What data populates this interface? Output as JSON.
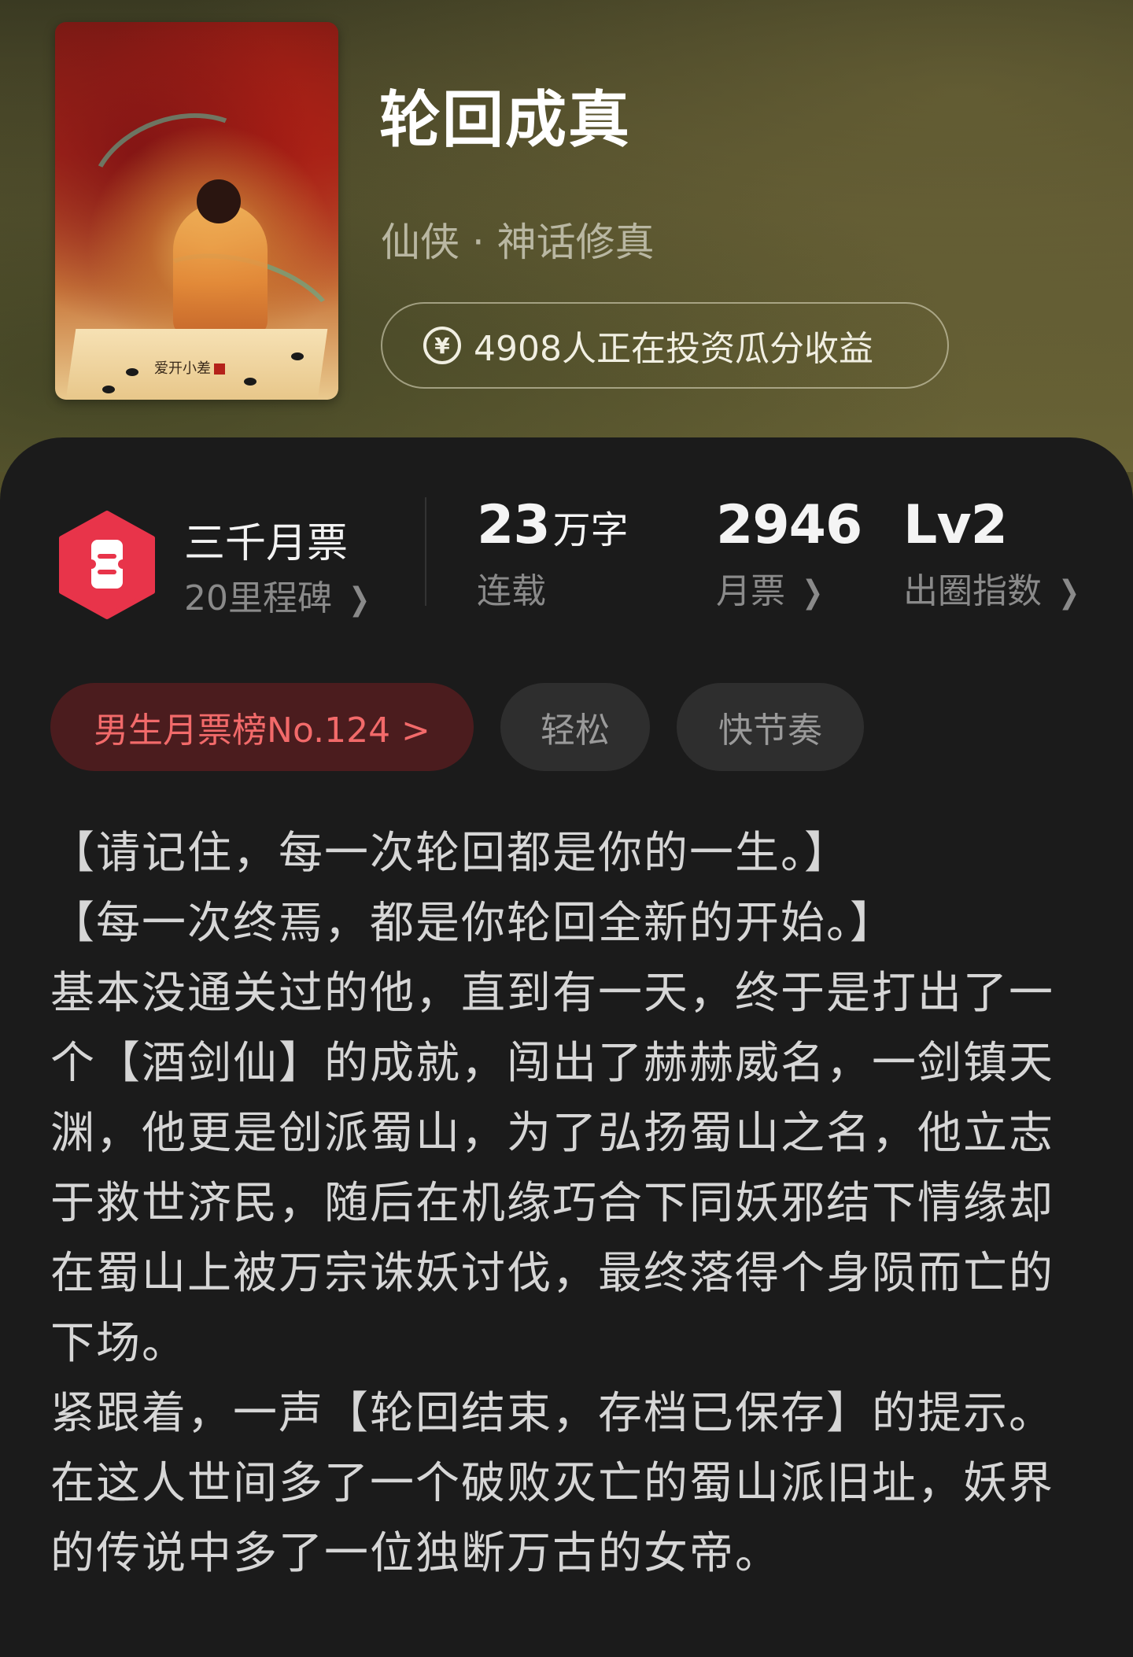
{
  "book": {
    "title": "轮回成真",
    "genre": "仙侠 · 神话修真",
    "invest_text": "4908人正在投资瓜分收益",
    "cover_author": "爱开小差"
  },
  "stats": {
    "ticket_title": "三千月票",
    "ticket_sub": "20里程碑",
    "words_value": "23",
    "words_unit": "万字",
    "words_label": "连载",
    "votes_value": "2946",
    "votes_label": "月票",
    "level_value": "Lv2",
    "level_label": "出圈指数"
  },
  "tags": {
    "rank": "男生月票榜No.124 >",
    "tag1": "轻松",
    "tag2": "快节奏"
  },
  "synopsis": [
    "【请记住，每一次轮回都是你的一生。】",
    "【每一次终焉，都是你轮回全新的开始。】",
    "基本没通关过的他，直到有一天，终于是打出了一个【酒剑仙】的成就，闯出了赫赫威名，一剑镇天渊，他更是创派蜀山，为了弘扬蜀山之名，他立志于救世济民，随后在机缘巧合下同妖邪结下情缘却在蜀山上被万宗诛妖讨伐，最终落得个身陨而亡的下场。",
    "紧跟着，一声【轮回结束，存档已保存】的提示。",
    "在这人世间多了一个破败灭亡的蜀山派旧址，妖界的传说中多了一位独断万古的女帝。"
  ],
  "colors": {
    "accent_red": "#e8344a",
    "rank_text": "#f26a6a",
    "rank_bg": "#4b1c1e",
    "card_bg": "#1b1b1b"
  },
  "icons": {
    "yen": "yen-circle-icon",
    "ticket": "ticket-hexagon-icon",
    "chevron": "chevron-right-icon"
  }
}
